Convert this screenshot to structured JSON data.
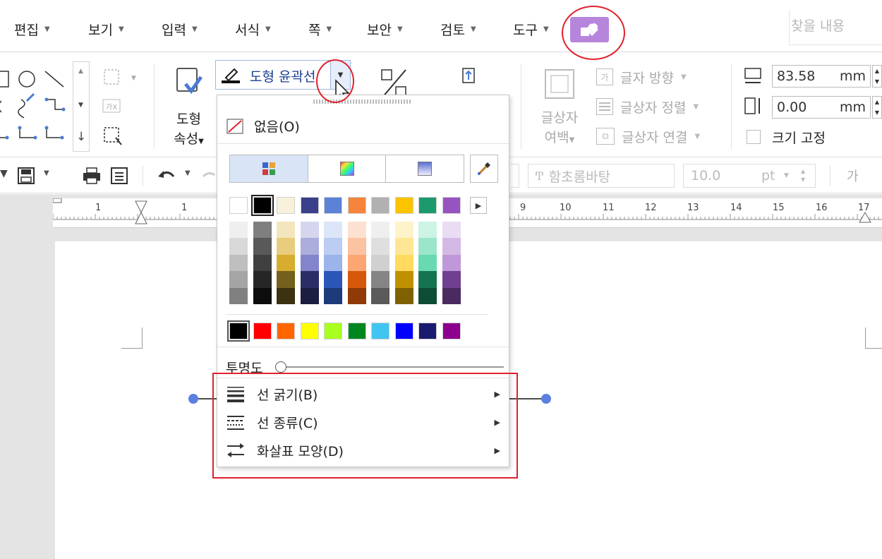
{
  "menubar": {
    "items": [
      {
        "label": "편집"
      },
      {
        "label": "보기"
      },
      {
        "label": "입력"
      },
      {
        "label": "서식"
      },
      {
        "label": "쪽"
      },
      {
        "label": "보안"
      },
      {
        "label": "검토"
      },
      {
        "label": "도구"
      }
    ],
    "search_placeholder": "찾을 내용"
  },
  "ribbon": {
    "shape_props_line1": "도형",
    "shape_props_line2": "속성",
    "outline_label": "도형 윤곽선",
    "textbox_margin_line1": "글상자",
    "textbox_margin_line2": "여백",
    "text_direction": "글자 방향",
    "text_align": "글상자 정렬",
    "text_link": "글상자 연결",
    "width_value": "83.58",
    "height_value": "0.00",
    "unit": "mm",
    "fix_size": "크기 고정"
  },
  "toolbar2": {
    "font_name": "함초롬바탕",
    "font_size": "10.0",
    "font_unit": "pt",
    "style_glyph": "가"
  },
  "ruler": {
    "left_labels": [
      "1",
      "1"
    ],
    "labels": [
      "9",
      "10",
      "11",
      "12",
      "13",
      "14",
      "15",
      "16",
      "17"
    ]
  },
  "dropdown": {
    "none_label": "없음(O)",
    "transparency_label": "투명도",
    "transparency": 0,
    "submenu": [
      {
        "label": "선 굵기(B)"
      },
      {
        "label": "선 종류(C)"
      },
      {
        "label": "화살표 모양(D)"
      }
    ],
    "top_colors": [
      "#ffffff",
      "#000000",
      "#f7f1dc",
      "#3a3f8c",
      "#5c82d8",
      "#f6843b",
      "#b1b1b1",
      "#fcc300",
      "#1d9a6c",
      "#9654c0"
    ],
    "gradients": [
      [
        "#efefef",
        "#d9d9d9",
        "#bfbfbf",
        "#a5a5a5",
        "#808080"
      ],
      [
        "#7f7f7f",
        "#595959",
        "#404040",
        "#262626",
        "#0d0d0d"
      ],
      [
        "#f3e6bc",
        "#e8cd7d",
        "#d6ad2f",
        "#75601c",
        "#3d320f"
      ],
      [
        "#d5d6ee",
        "#acaddd",
        "#8284cc",
        "#2b2e66",
        "#1b1d41"
      ],
      [
        "#dde6f8",
        "#bccdf1",
        "#9bb4eb",
        "#2c57b9",
        "#1d3a7b"
      ],
      [
        "#fde1d0",
        "#fcc3a2",
        "#fba673",
        "#d7580b",
        "#8f3a07"
      ],
      [
        "#efefef",
        "#dfdfdf",
        "#d0d0d0",
        "#858585",
        "#5a5a5a"
      ],
      [
        "#fff3c9",
        "#ffe694",
        "#ffda5e",
        "#bf9100",
        "#7f6100"
      ],
      [
        "#cdf3e5",
        "#9be6cb",
        "#69d9b1",
        "#167350",
        "#0e4d35"
      ],
      [
        "#eadcf2",
        "#d5b9e5",
        "#c097d8",
        "#703f92",
        "#4b2a61"
      ]
    ],
    "std_colors": [
      "#000000",
      "#ff0000",
      "#ff6600",
      "#ffff00",
      "#a9ff1f",
      "#00861e",
      "#40c4f0",
      "#0000ff",
      "#1b1b6e",
      "#8d008d"
    ]
  },
  "colors": {
    "accent_purple": "#b685dc",
    "highlight_red": "#e0202e",
    "handle_blue": "#5b80e0"
  }
}
